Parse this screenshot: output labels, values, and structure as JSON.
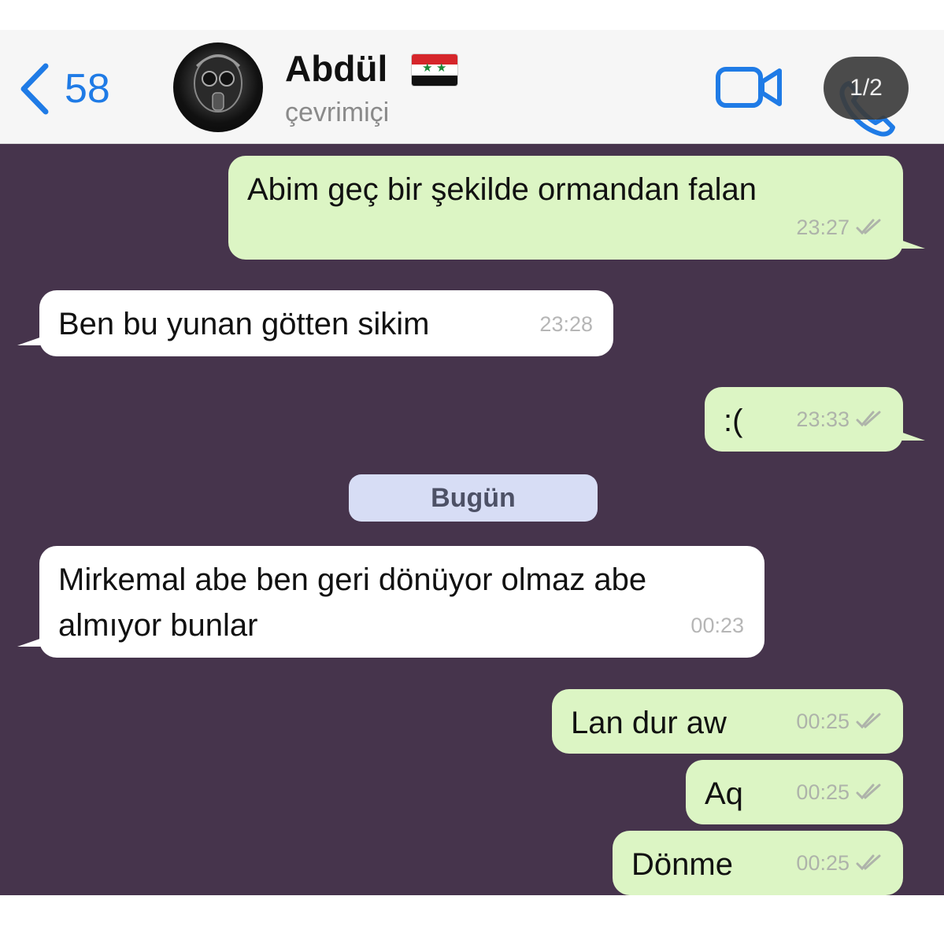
{
  "header": {
    "back_count": "58",
    "contact_name": "Abdül",
    "status": "çevrimiçi",
    "page_indicator": "1/2",
    "accent_color": "#1f7be6"
  },
  "chat": {
    "background_color": "#46344c",
    "date_divider": "Bugün",
    "messages": [
      {
        "direction": "outgoing",
        "text": "Abim geç bir şekilde ormandan falan",
        "time": "23:27",
        "read": true
      },
      {
        "direction": "incoming",
        "text": "Ben bu yunan götten sikim",
        "time": "23:28"
      },
      {
        "direction": "outgoing",
        "text": ":(",
        "time": "23:33",
        "read": true
      },
      {
        "direction": "incoming",
        "text": "Mirkemal abe ben geri dönüyor olmaz abe almıyor bunlar",
        "time": "00:23"
      },
      {
        "direction": "outgoing",
        "text": "Lan dur aw",
        "time": "00:25",
        "read": true
      },
      {
        "direction": "outgoing",
        "text": "Aq",
        "time": "00:25",
        "read": true
      },
      {
        "direction": "outgoing",
        "text": "Dönme",
        "time": "00:25",
        "read": true
      }
    ]
  },
  "icons": {
    "back": "chevron-left-icon",
    "video": "video-camera-icon",
    "phone": "phone-icon",
    "read_receipt": "double-check-icon"
  }
}
